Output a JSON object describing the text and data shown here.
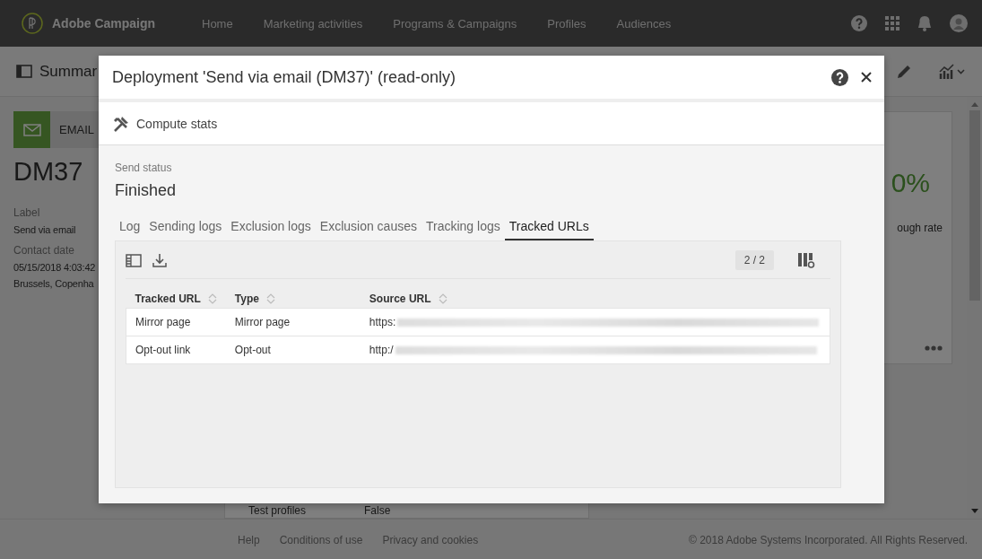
{
  "top_nav": {
    "brand": "Adobe Campaign",
    "items": [
      {
        "label": "Home"
      },
      {
        "label": "Marketing activities"
      },
      {
        "label": "Programs & Campaigns"
      },
      {
        "label": "Profiles"
      },
      {
        "label": "Audiences"
      }
    ]
  },
  "sub_header": {
    "title": "Summar"
  },
  "summary": {
    "channel": "EMAIL",
    "code": "DM37",
    "fields": [
      {
        "label": "Label",
        "lines": [
          "Send via email"
        ]
      },
      {
        "label": "Contact date",
        "lines": [
          "05/15/2018 4:03:42",
          "Brussels, Copenha"
        ]
      }
    ]
  },
  "properties": [
    {
      "label": "Test profiles",
      "value": "False"
    }
  ],
  "stats_card": {
    "rate": "0%",
    "caption": "ough rate"
  },
  "footer": {
    "links": [
      "Help",
      "Conditions of use",
      "Privacy and cookies"
    ],
    "copyright": "© 2018 Adobe Systems Incorporated. All Rights Reserved."
  },
  "dialog": {
    "title": "Deployment 'Send via email (DM37)' (read-only)",
    "action": "Compute stats",
    "status_label": "Send status",
    "status": "Finished",
    "tabs": [
      {
        "label": "Log",
        "selected": false
      },
      {
        "label": "Sending logs",
        "selected": false
      },
      {
        "label": "Exclusion logs",
        "selected": false
      },
      {
        "label": "Exclusion causes",
        "selected": false
      },
      {
        "label": "Tracking logs",
        "selected": false
      },
      {
        "label": "Tracked URLs",
        "selected": true
      }
    ],
    "table": {
      "count": "2 / 2",
      "columns": [
        "Tracked URL",
        "Type",
        "Source URL"
      ],
      "rows": [
        [
          "Mirror page",
          "Mirror page",
          "https:"
        ],
        [
          "Opt-out link",
          "Opt-out",
          "http:/"
        ]
      ]
    }
  }
}
